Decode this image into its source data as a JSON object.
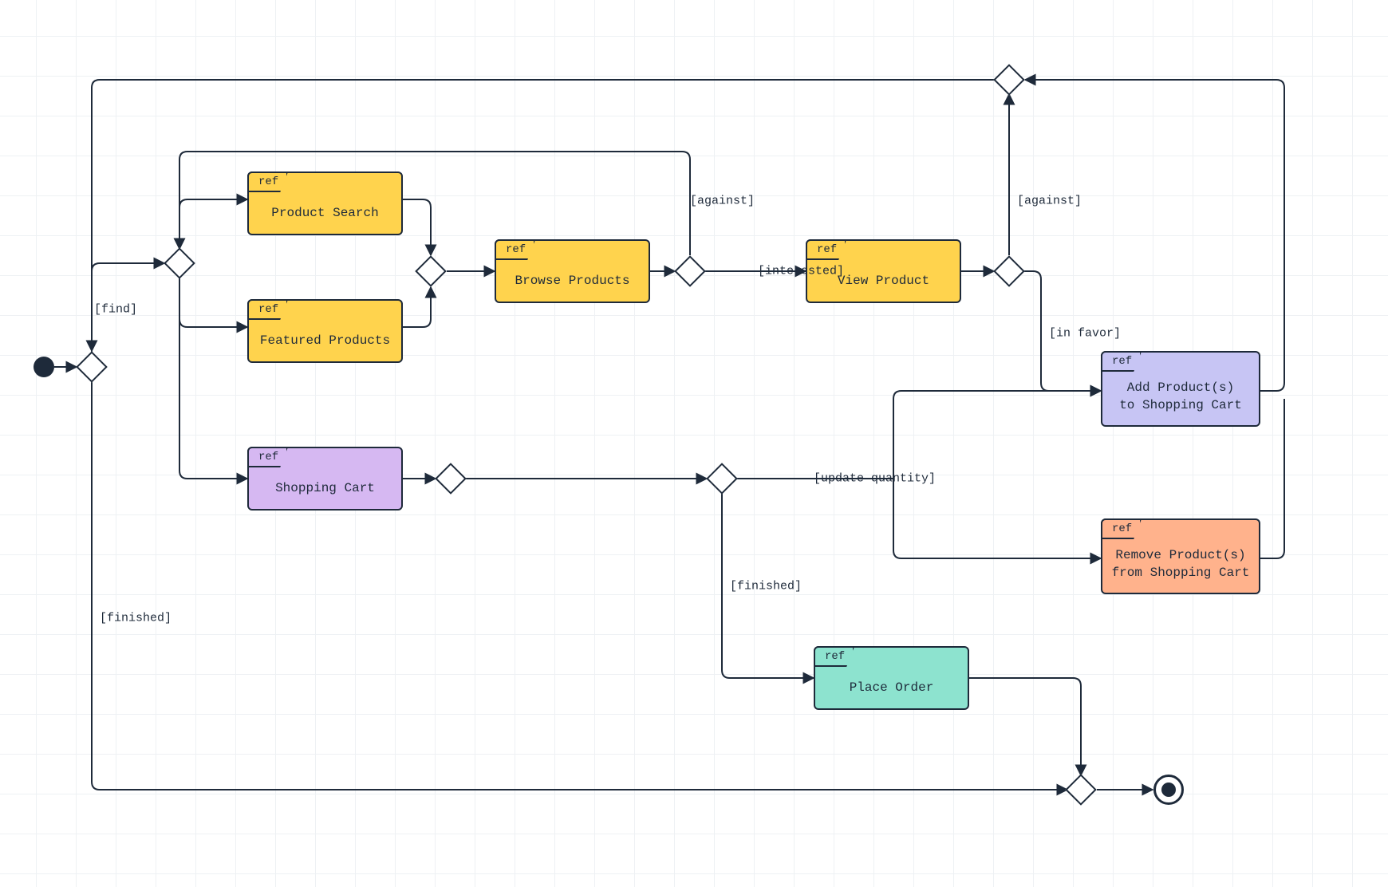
{
  "ref_tag_label": "ref",
  "nodes": {
    "product_search": {
      "label": "Product Search"
    },
    "featured_products": {
      "label": "Featured Products"
    },
    "browse_products": {
      "label": "Browse Products"
    },
    "view_product": {
      "label": "View Product"
    },
    "shopping_cart": {
      "label": "Shopping Cart"
    },
    "place_order": {
      "label": "Place Order"
    },
    "add_product": {
      "label": "Add Product(s)\nto Shopping Cart"
    },
    "remove_product": {
      "label": "Remove Product(s)\nfrom Shopping Cart"
    }
  },
  "edge_labels": {
    "find": "[find]",
    "finished_left": "[finished]",
    "against_top": "[against]",
    "interested": "[interested]",
    "against_right": "[against]",
    "in_favor": "[in favor]",
    "update_quantity": "[update quantity]",
    "finished_mid": "[finished]"
  },
  "colors": {
    "stroke": "#1e2a3a",
    "yellow": "#ffd34d",
    "purple": "#d6b8f2",
    "teal": "#8de3cf",
    "lilac": "#c7c5f4",
    "orange": "#ffb28c"
  }
}
